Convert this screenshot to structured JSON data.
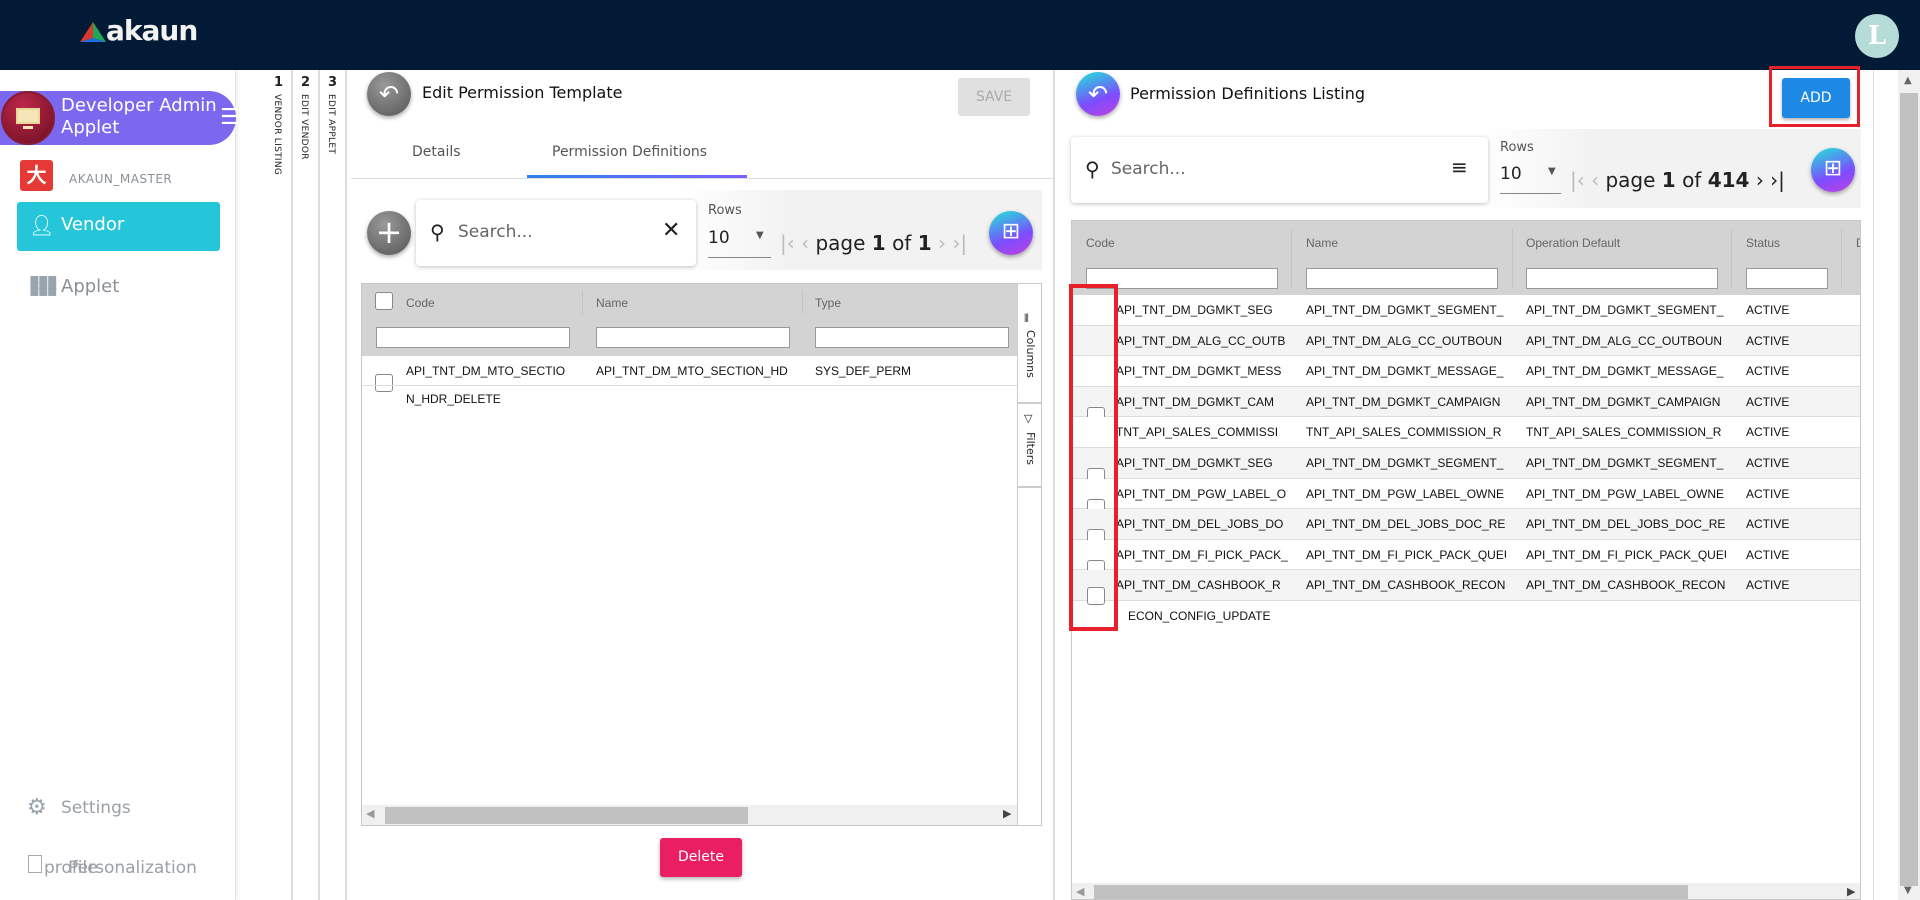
{
  "topbar": {
    "logo_text": "akaun",
    "avatar_letter": "L"
  },
  "sidebar": {
    "applet_name": "Developer Admin Applet",
    "master_logo_glyph": "大",
    "master_name": "AKAUN_MASTER",
    "items": [
      {
        "label": "Vendor",
        "icon": "person-icon",
        "active": true
      },
      {
        "label": "Applet",
        "icon": "apps-grid-icon",
        "active": false
      }
    ],
    "settings_label": "Settings",
    "profile_label": "profile",
    "personalization_label": "Personalization"
  },
  "steps": [
    {
      "num": "1",
      "label": "VENDOR LISTING"
    },
    {
      "num": "2",
      "label": "EDIT VENDOR"
    },
    {
      "num": "3",
      "label": "EDIT APPLET"
    }
  ],
  "left": {
    "title": "Edit Permission Template",
    "save_label": "SAVE",
    "tabs": [
      {
        "label": "Details"
      },
      {
        "label": "Permission Definitions",
        "active": true
      }
    ],
    "search_placeholder": "Search...",
    "rows_label": "Rows",
    "rows_value": "10",
    "page_word": "page",
    "page": "1",
    "of_word": "of",
    "total_pages": "1",
    "columns": [
      "Code",
      "Name",
      "Type"
    ],
    "rows": [
      {
        "code_line1": "API_TNT_DM_MTO_SECTIO",
        "code_line2": "N_HDR_DELETE",
        "name": "API_TNT_DM_MTO_SECTION_HD",
        "type": "SYS_DEF_PERM"
      }
    ],
    "side_columns": "Columns",
    "side_filters": "Filters",
    "delete_label": "Delete"
  },
  "right": {
    "title": "Permission Definitions Listing",
    "add_label": "ADD",
    "search_placeholder": "Search...",
    "rows_label": "Rows",
    "rows_value": "10",
    "page_word": "page",
    "page": "1",
    "of_word": "of",
    "total_pages": "414",
    "columns": [
      "Code",
      "Name",
      "Operation Default",
      "Status",
      "D"
    ],
    "rows": [
      {
        "code": "API_TNT_DM_DGMKT_SEG",
        "name": "API_TNT_DM_DGMKT_SEGMENT_",
        "op": "API_TNT_DM_DGMKT_SEGMENT_",
        "status": "ACTIVE"
      },
      {
        "code": "API_TNT_DM_ALG_CC_OUTB",
        "name": "API_TNT_DM_ALG_CC_OUTBOUN",
        "op": "API_TNT_DM_ALG_CC_OUTBOUN",
        "status": "ACTIVE"
      },
      {
        "code": "API_TNT_DM_DGMKT_MESS",
        "name": "API_TNT_DM_DGMKT_MESSAGE_",
        "op": "API_TNT_DM_DGMKT_MESSAGE_",
        "status": "ACTIVE"
      },
      {
        "code": "API_TNT_DM_DGMKT_CAM",
        "name": "API_TNT_DM_DGMKT_CAMPAIGN",
        "op": "API_TNT_DM_DGMKT_CAMPAIGN",
        "status": "ACTIVE"
      },
      {
        "code": "TNT_API_SALES_COMMISSI",
        "name": "TNT_API_SALES_COMMISSION_R",
        "op": "TNT_API_SALES_COMMISSION_R",
        "status": "ACTIVE"
      },
      {
        "code": "API_TNT_DM_DGMKT_SEG",
        "name": "API_TNT_DM_DGMKT_SEGMENT_",
        "op": "API_TNT_DM_DGMKT_SEGMENT_",
        "status": "ACTIVE"
      },
      {
        "code": "API_TNT_DM_PGW_LABEL_O",
        "name": "API_TNT_DM_PGW_LABEL_OWNE",
        "op": "API_TNT_DM_PGW_LABEL_OWNE",
        "status": "ACTIVE"
      },
      {
        "code": "API_TNT_DM_DEL_JOBS_DO",
        "name": "API_TNT_DM_DEL_JOBS_DOC_RE",
        "op": "API_TNT_DM_DEL_JOBS_DOC_RE",
        "status": "ACTIVE"
      },
      {
        "code": "API_TNT_DM_FI_PICK_PACK_",
        "name": "API_TNT_DM_FI_PICK_PACK_QUEU",
        "op": "API_TNT_DM_FI_PICK_PACK_QUEU",
        "status": "ACTIVE"
      },
      {
        "code": "API_TNT_DM_CASHBOOK_R",
        "name": "API_TNT_DM_CASHBOOK_RECON",
        "op": "API_TNT_DM_CASHBOOK_RECON",
        "status": "ACTIVE"
      }
    ],
    "overflow_text": "ECON_CONFIG_UPDATE"
  },
  "colors": {
    "topbar": "#021a35",
    "applet_pill": "#7b68ee",
    "vendor_active": "#26c6da",
    "add": "#1e88e5",
    "delete": "#e91e63",
    "highlight": "#e8202a"
  }
}
